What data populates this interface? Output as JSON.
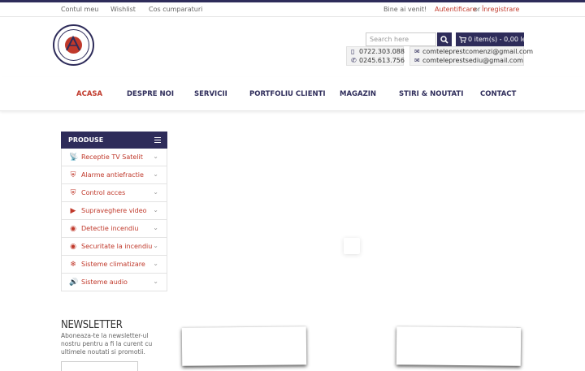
{
  "topbar": {
    "account": "Contul meu",
    "wishlist": "Wishlist",
    "cart_link": "Cos cumparaturi",
    "welcome": "Bine ai venit!",
    "login": "Autentificare",
    "or": "or",
    "register": "Înregistrare"
  },
  "logo": {
    "alt_text": "COMTELEPREST"
  },
  "search": {
    "placeholder": "Search here"
  },
  "cart": {
    "label": "0 item(s) - 0,00 lei"
  },
  "contacts": {
    "phone_mobile": "0722.303.088",
    "phone_fixed": "0245.613.756",
    "email_orders": "comteleprestcomenzi@gmail.com",
    "email_office": "comteleprestsediu@gmail.com"
  },
  "nav": {
    "items": [
      {
        "label": "ACASA",
        "active": true
      },
      {
        "label": "DESPRE NOI"
      },
      {
        "label": "SERVICII"
      },
      {
        "label": "PORTFOLIU CLIENTI"
      },
      {
        "label": "MAGAZIN"
      },
      {
        "label": "STIRI & NOUTATI"
      },
      {
        "label": "CONTACT"
      }
    ]
  },
  "products": {
    "title": "PRODUSE",
    "items": [
      {
        "label": "Receptie TV Satelit",
        "icon": "satellite-dish-icon"
      },
      {
        "label": "Alarme antiefractie",
        "icon": "shield-icon"
      },
      {
        "label": "Control acces",
        "icon": "shield-icon"
      },
      {
        "label": "Supraveghere video",
        "icon": "camera-icon"
      },
      {
        "label": "Detectie incendiu",
        "icon": "fire-sensor-icon"
      },
      {
        "label": "Securitate la incendiu",
        "icon": "fire-sensor-icon"
      },
      {
        "label": "Sisteme climatizare",
        "icon": "snowflake-icon"
      },
      {
        "label": "Sisteme audio",
        "icon": "speaker-icon"
      }
    ]
  },
  "newsletter": {
    "title": "NEWSLETTER",
    "description": "Aboneaza-te la newsletter-ul nostru pentru a fi la curent cu ultimele noutati si promotii."
  },
  "colors": {
    "primary": "#2e2c5a",
    "accent": "#c0392b"
  }
}
